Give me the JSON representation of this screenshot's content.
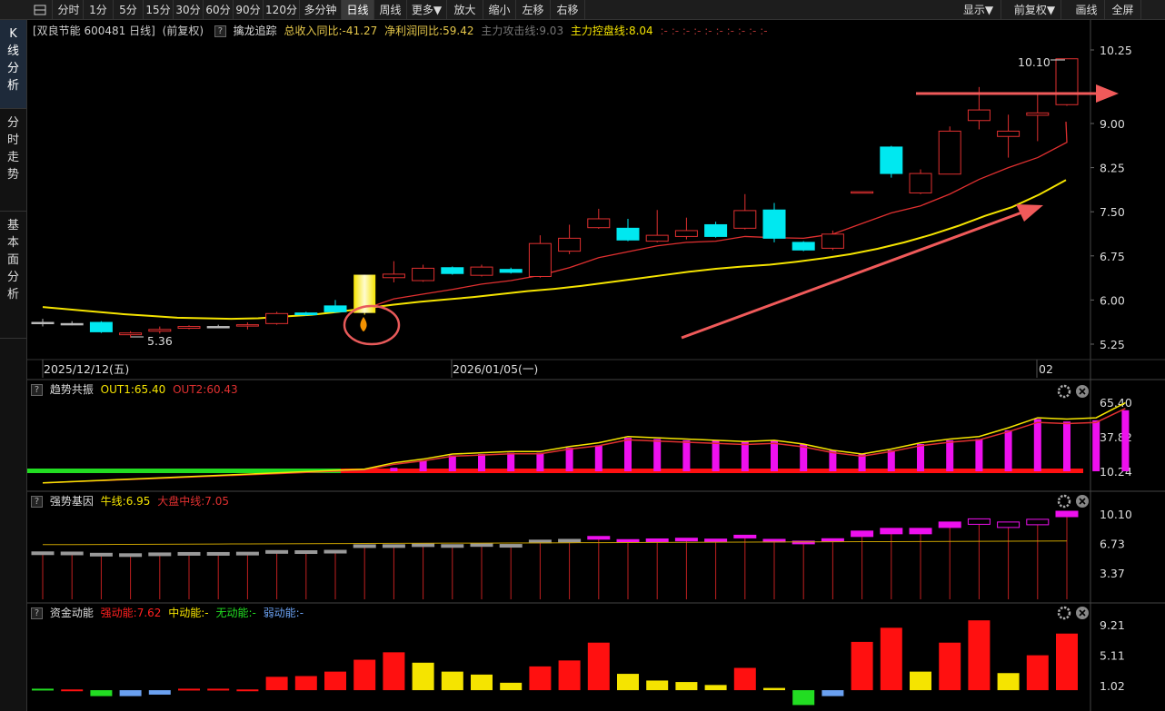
{
  "toolbar": {
    "left_items": [
      "分时",
      "1分",
      "5分",
      "15分",
      "30分",
      "60分",
      "90分",
      "120分",
      "多分钟",
      "日线",
      "周线",
      "更多▼",
      "放大",
      "缩小",
      "左移",
      "右移"
    ],
    "right_items": [
      "显示▼",
      "前复权▼",
      "画线",
      "全屏"
    ],
    "active": "日线"
  },
  "sidebar": {
    "tabs": [
      "K线分析",
      "分时走势",
      "基本面分析"
    ],
    "active": "K线分析"
  },
  "main_header": {
    "stock": "[双良节能 600481 日线]",
    "adjust": "(前复权)",
    "indicator": "擒龙追踪",
    "rev_yoy": "总收入同比:-41.27",
    "profit_yoy": "净利润同比:59.42",
    "attack": "主力攻击线:9.03",
    "control": "主力控盘线:8.04",
    "tail": ":- :- :- :- :- :- :- :- :- :-"
  },
  "main_axis": {
    "labels": [
      "10.25",
      "9.00",
      "8.25",
      "7.50",
      "6.75",
      "6.00",
      "5.25"
    ],
    "values": [
      10.25,
      9.0,
      8.25,
      7.5,
      6.75,
      6.0,
      5.25
    ]
  },
  "annotations": {
    "high_label": "10.10",
    "low_label": "5.36"
  },
  "date_axis": {
    "labels": [
      "2025/12/12(五)",
      "2026/01/05(一)",
      "02"
    ]
  },
  "panel1": {
    "name": "趋势共振",
    "out1": "OUT1:65.40",
    "out2": "OUT2:60.43",
    "axis": [
      "65.40",
      "37.82",
      "10.24"
    ],
    "axis_values": [
      65.4,
      37.82,
      10.24
    ]
  },
  "panel2": {
    "name": "强势基因",
    "bull": "牛线:6.95",
    "market": "大盘中线:7.05",
    "axis": [
      "10.10",
      "6.73",
      "3.37"
    ],
    "axis_values": [
      10.1,
      6.73,
      3.37
    ]
  },
  "panel3": {
    "name": "资金动能",
    "strong": "强动能:7.62",
    "medium": "中动能:-",
    "none": "无动能:-",
    "weak": "弱动能:-",
    "axis": [
      "9.21",
      "5.11",
      "1.02"
    ],
    "axis_values": [
      9.21,
      5.11,
      1.02
    ]
  },
  "chart_data": {
    "type": "candlestick",
    "y_range": [
      5.25,
      10.25
    ],
    "candles": [
      {
        "o": 5.62,
        "c": 5.62,
        "h": 5.68,
        "l": 5.55,
        "color": "gray"
      },
      {
        "o": 5.6,
        "c": 5.6,
        "h": 5.64,
        "l": 5.57,
        "color": "gray"
      },
      {
        "o": 5.62,
        "c": 5.46,
        "h": 5.64,
        "l": 5.44,
        "color": "cyan"
      },
      {
        "o": 5.44,
        "c": 5.41,
        "h": 5.47,
        "l": 5.36,
        "color": "red"
      },
      {
        "o": 5.47,
        "c": 5.5,
        "h": 5.55,
        "l": 5.43,
        "color": "red"
      },
      {
        "o": 5.52,
        "c": 5.55,
        "h": 5.57,
        "l": 5.5,
        "color": "red"
      },
      {
        "o": 5.55,
        "c": 5.55,
        "h": 5.58,
        "l": 5.52,
        "color": "gray"
      },
      {
        "o": 5.56,
        "c": 5.58,
        "h": 5.62,
        "l": 5.5,
        "color": "red"
      },
      {
        "o": 5.6,
        "c": 5.77,
        "h": 5.8,
        "l": 5.58,
        "color": "red"
      },
      {
        "o": 5.78,
        "c": 5.75,
        "h": 5.8,
        "l": 5.73,
        "color": "cyan"
      },
      {
        "o": 5.9,
        "c": 5.8,
        "h": 6.0,
        "l": 5.78,
        "color": "cyan"
      },
      {
        "o": 5.78,
        "c": 6.43,
        "h": 6.43,
        "l": 5.75,
        "color": "yellow"
      },
      {
        "o": 6.38,
        "c": 6.44,
        "h": 6.66,
        "l": 6.3,
        "color": "red"
      },
      {
        "o": 6.33,
        "c": 6.54,
        "h": 6.6,
        "l": 6.31,
        "color": "red"
      },
      {
        "o": 6.55,
        "c": 6.45,
        "h": 6.57,
        "l": 6.43,
        "color": "cyan"
      },
      {
        "o": 6.42,
        "c": 6.56,
        "h": 6.6,
        "l": 6.4,
        "color": "red"
      },
      {
        "o": 6.52,
        "c": 6.47,
        "h": 6.55,
        "l": 6.45,
        "color": "cyan"
      },
      {
        "o": 6.4,
        "c": 6.96,
        "h": 7.1,
        "l": 6.38,
        "color": "red"
      },
      {
        "o": 6.83,
        "c": 7.05,
        "h": 7.28,
        "l": 6.78,
        "color": "red"
      },
      {
        "o": 7.23,
        "c": 7.38,
        "h": 7.55,
        "l": 7.21,
        "color": "red"
      },
      {
        "o": 7.22,
        "c": 7.02,
        "h": 7.38,
        "l": 7.0,
        "color": "cyan"
      },
      {
        "o": 7.0,
        "c": 7.1,
        "h": 7.53,
        "l": 6.98,
        "color": "red"
      },
      {
        "o": 7.08,
        "c": 7.18,
        "h": 7.4,
        "l": 7.03,
        "color": "red"
      },
      {
        "o": 7.28,
        "c": 7.08,
        "h": 7.33,
        "l": 7.06,
        "color": "cyan"
      },
      {
        "o": 7.22,
        "c": 7.52,
        "h": 7.8,
        "l": 7.2,
        "color": "red"
      },
      {
        "o": 7.53,
        "c": 7.05,
        "h": 7.65,
        "l": 6.98,
        "color": "cyan"
      },
      {
        "o": 6.98,
        "c": 6.85,
        "h": 7.0,
        "l": 6.83,
        "color": "cyan"
      },
      {
        "o": 6.88,
        "c": 7.12,
        "h": 7.18,
        "l": 6.85,
        "color": "red"
      },
      {
        "o": 7.82,
        "c": 7.84,
        "h": 7.84,
        "l": 7.82,
        "color": "red"
      },
      {
        "o": 8.6,
        "c": 8.15,
        "h": 8.62,
        "l": 8.08,
        "color": "cyan"
      },
      {
        "o": 7.82,
        "c": 8.15,
        "h": 8.22,
        "l": 7.8,
        "color": "red"
      },
      {
        "o": 8.14,
        "c": 8.87,
        "h": 8.95,
        "l": 8.14,
        "color": "red"
      },
      {
        "o": 9.05,
        "c": 9.23,
        "h": 9.62,
        "l": 8.9,
        "color": "red"
      },
      {
        "o": 8.78,
        "c": 8.87,
        "h": 9.15,
        "l": 8.42,
        "color": "red"
      },
      {
        "o": 9.14,
        "c": 9.18,
        "h": 9.53,
        "l": 8.7,
        "color": "red"
      },
      {
        "o": 9.32,
        "c": 10.1,
        "h": 10.1,
        "l": 9.3,
        "color": "red"
      }
    ],
    "ma_red": [
      null,
      null,
      null,
      null,
      null,
      null,
      null,
      null,
      null,
      null,
      null,
      5.85,
      6.02,
      6.1,
      6.18,
      6.27,
      6.33,
      6.42,
      6.55,
      6.72,
      6.82,
      6.92,
      6.98,
      7.0,
      7.08,
      7.06,
      7.05,
      7.12,
      7.3,
      7.48,
      7.6,
      7.8,
      8.05,
      8.25,
      8.42,
      8.68
    ],
    "ma_yellow": [
      5.88,
      5.84,
      5.8,
      5.76,
      5.73,
      5.7,
      5.69,
      5.68,
      5.69,
      5.72,
      5.75,
      5.8,
      5.86,
      5.92,
      5.97,
      6.01,
      6.05,
      6.1,
      6.15,
      6.19,
      6.24,
      6.3,
      6.36,
      6.42,
      6.48,
      6.53,
      6.57,
      6.6,
      6.65,
      6.71,
      6.78,
      6.87,
      6.98,
      7.11,
      7.26,
      7.43,
      7.58,
      7.79,
      8.04
    ]
  }
}
